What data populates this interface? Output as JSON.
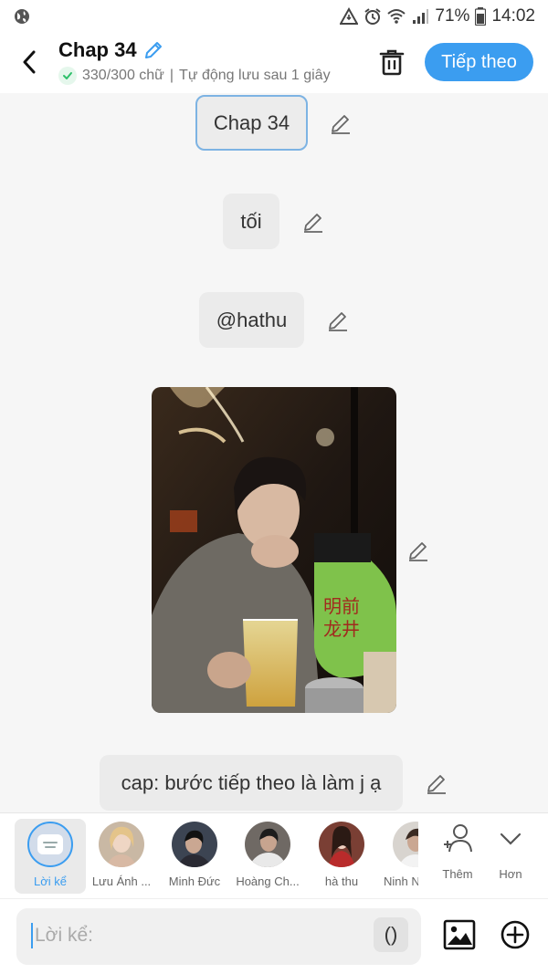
{
  "status_bar": {
    "battery": "71%",
    "time": "14:02"
  },
  "header": {
    "title": "Chap 34",
    "word_count": "330/300 chữ",
    "autosave": "Tự động lưu sau 1 giây",
    "separator": "|",
    "next_button": "Tiếp theo"
  },
  "messages": {
    "chapter_title": "Chap 34",
    "msg1": "tối",
    "msg2": "@hathu",
    "msg4": "cap: bước tiếp theo là làm j ạ"
  },
  "characters": {
    "narrator": "Lời kể",
    "c1": "Lưu Ánh ...",
    "c2": "Minh Đức",
    "c3": "Hoàng Ch...",
    "c4": "hà thu",
    "c5": "Ninh N..."
  },
  "tools": {
    "add_label": "Thêm",
    "more_label": "Hơn"
  },
  "input": {
    "placeholder": "Lời kể:",
    "paren_label": "()"
  },
  "colors": {
    "accent": "#3b9df0",
    "bubble": "#ebebeb",
    "background": "#f6f6f6"
  }
}
